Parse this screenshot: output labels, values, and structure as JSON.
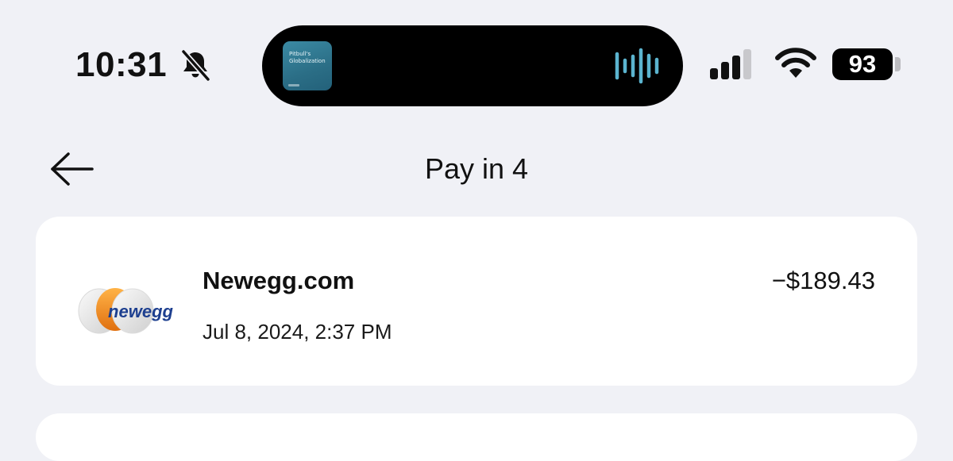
{
  "status_bar": {
    "time": "10:31",
    "bell_icon": "bell-slash-icon",
    "now_playing": {
      "album_title": "Pitbull's Globalization",
      "art_color": "#2b6e86",
      "waveform_color": "#5bb4cf",
      "waveform_icon": "waveform-icon"
    },
    "signal_icon": "cellular-signal-icon",
    "wifi_icon": "wifi-icon",
    "battery_level": "93"
  },
  "nav": {
    "back_icon": "arrow-left-icon",
    "title": "Pay in 4"
  },
  "transaction": {
    "merchant_logo": "newegg",
    "merchant_logo_text": "newegg",
    "merchant_name": "Newegg.com",
    "datetime": "Jul 8, 2024, 2:37 PM",
    "amount": "−$189.43"
  },
  "colors": {
    "background": "#f0f1f6",
    "card": "#ffffff",
    "brand_orange": "#f08a1c",
    "brand_blue": "#1d3f8f"
  }
}
